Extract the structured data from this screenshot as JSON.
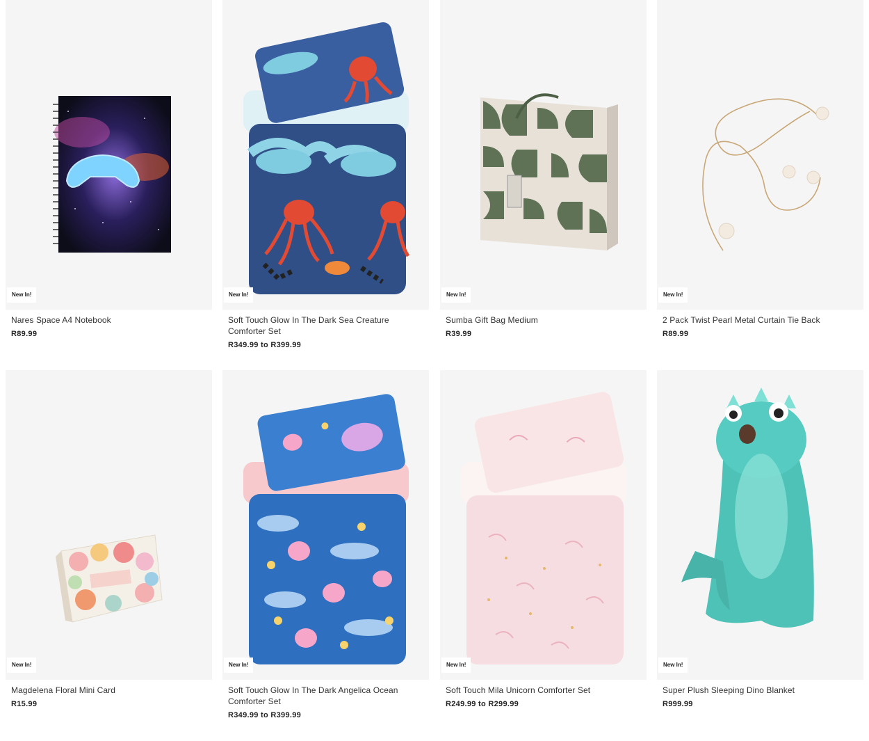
{
  "products": [
    {
      "name": "Nares Space A4 Notebook",
      "price": "R89.99",
      "badge": "New In!",
      "icon": "notebook-image"
    },
    {
      "name": "Soft Touch Glow In The Dark Sea Creature Comforter Set",
      "price": "R349.99 to R399.99",
      "badge": "New In!",
      "icon": "comforter-image"
    },
    {
      "name": "Sumba Gift Bag Medium",
      "price": "R39.99",
      "badge": "New In!",
      "icon": "gift-bag-image"
    },
    {
      "name": "2 Pack Twist Pearl Metal Curtain Tie Back",
      "price": "R89.99",
      "badge": "New In!",
      "icon": "curtain-tie-image"
    },
    {
      "name": "Magdelena Floral Mini Card",
      "price": "R15.99",
      "badge": "New In!",
      "icon": "card-image"
    },
    {
      "name": "Soft Touch Glow In The Dark Angelica Ocean Comforter Set",
      "price": "R349.99 to R399.99",
      "badge": "New In!",
      "icon": "comforter-image"
    },
    {
      "name": "Soft Touch Mila Unicorn Comforter Set",
      "price": "R249.99 to R299.99",
      "badge": "New In!",
      "icon": "comforter-image"
    },
    {
      "name": "Super Plush Sleeping Dino Blanket",
      "price": "R999.99",
      "badge": "New In!",
      "icon": "sleeping-bag-image"
    }
  ],
  "colors": {
    "tile_bg": "#f5f5f5",
    "sea_navy": "#2f4f86",
    "octopus_red": "#e24a33",
    "bag_green": "#5f7256",
    "ocean_blue": "#2e6fc0",
    "unicorn_pink": "#f6dde1",
    "dino_teal": "#4fc2b8"
  }
}
